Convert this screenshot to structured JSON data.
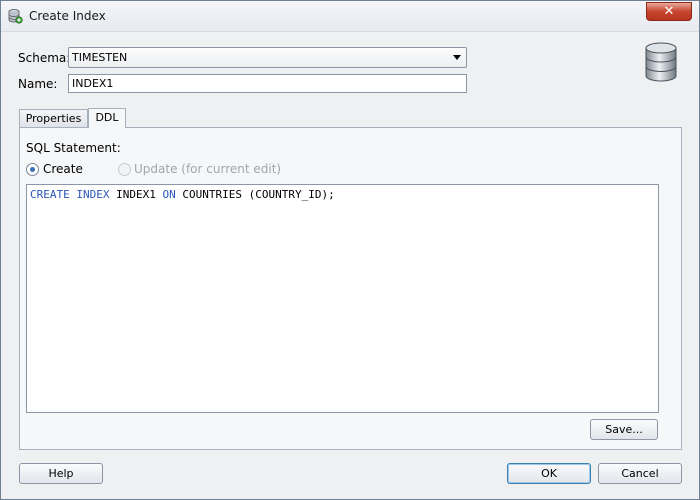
{
  "window": {
    "title": "Create Index",
    "close_label": "✕"
  },
  "form": {
    "schema_label": "Schema:",
    "schema_value": "TIMESTEN",
    "name_label": "Name:",
    "name_value": "INDEX1"
  },
  "tabs": [
    {
      "label": "Properties"
    },
    {
      "label": "DDL"
    }
  ],
  "ddl": {
    "sql_label": "SQL Statement:",
    "create_label": "Create",
    "update_label": "Update (for current edit)",
    "sql_kw_create": "CREATE",
    "sql_kw_index": "INDEX",
    "sql_name": "INDEX1",
    "sql_kw_on": "ON",
    "sql_rest": "COUNTRIES (COUNTRY_ID);",
    "save_label": "Save..."
  },
  "footer": {
    "help_label": "Help",
    "ok_label": "OK",
    "cancel_label": "Cancel"
  },
  "colors": {
    "keyword": "#2a57b7",
    "close_button": "#c8452f",
    "default_button_border": "#3c7fb1"
  },
  "icons": {
    "title": "database-icon",
    "header": "database-cylinder-icon"
  }
}
